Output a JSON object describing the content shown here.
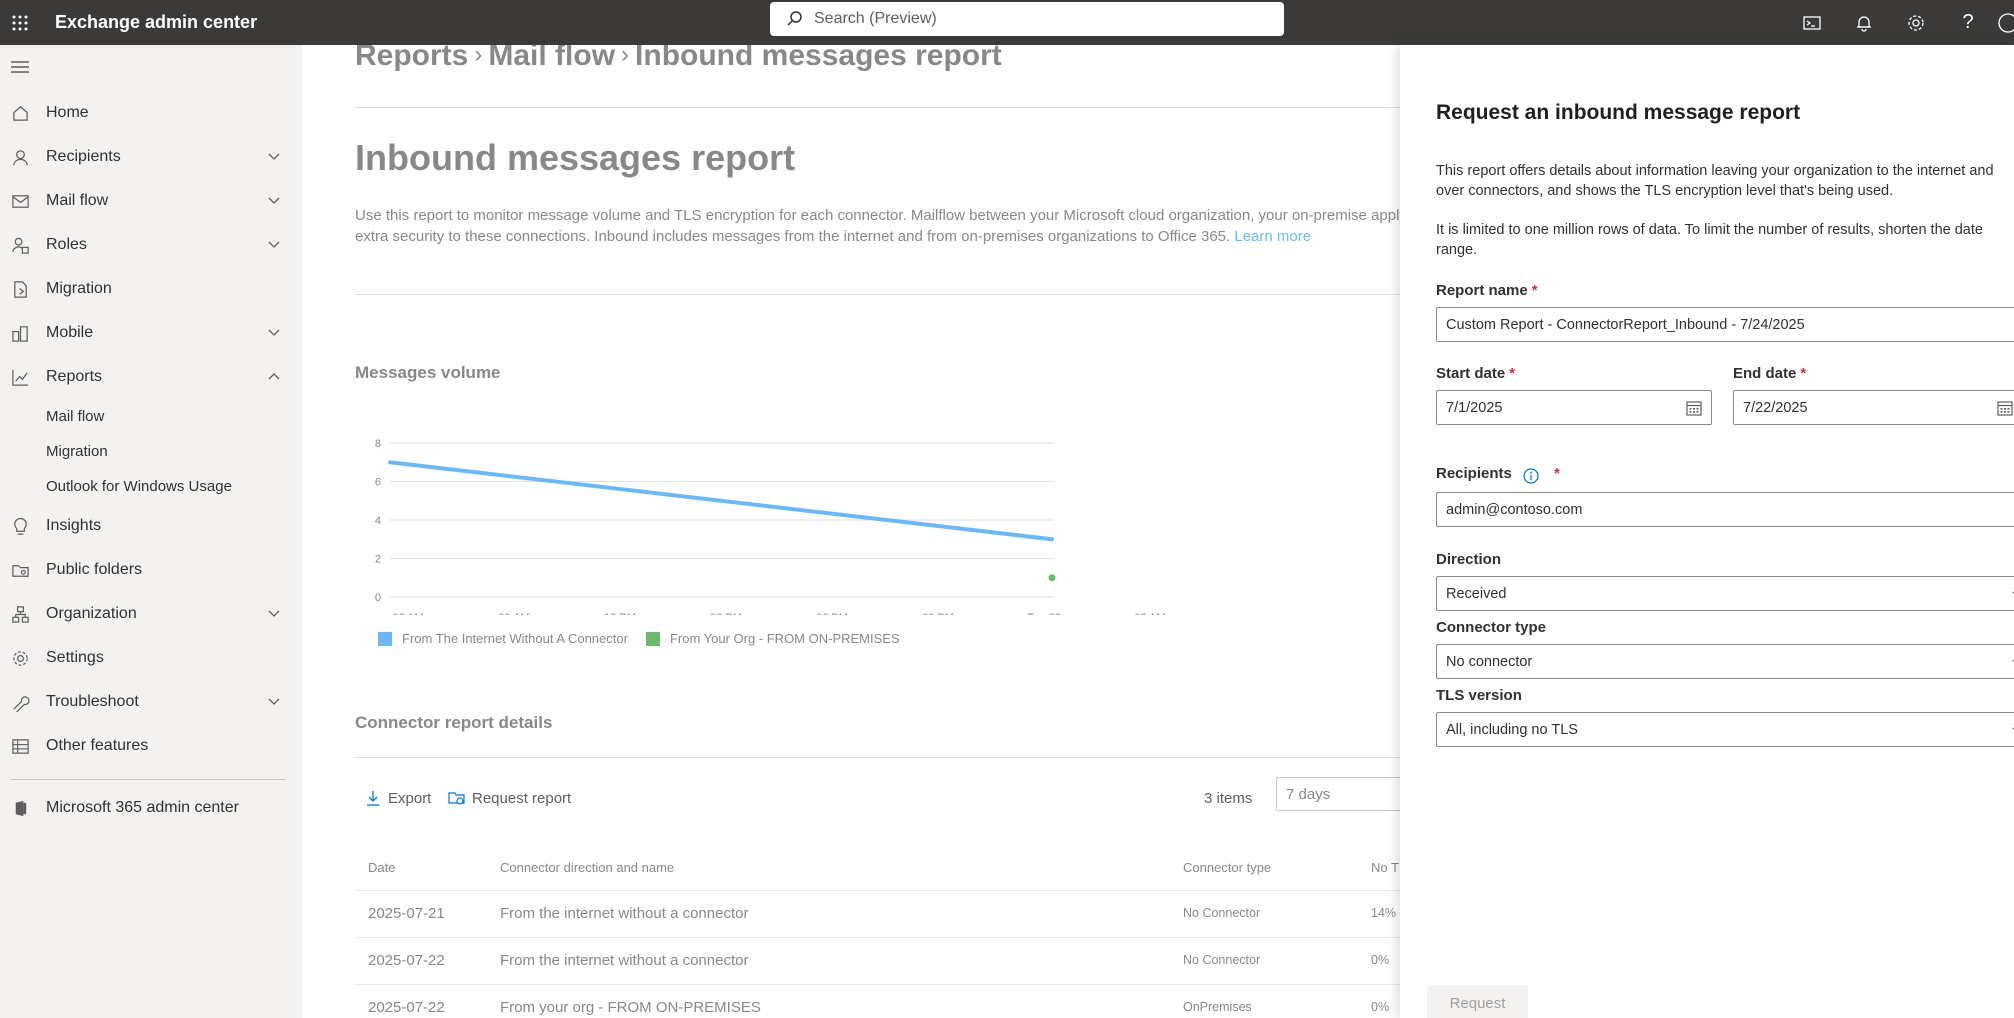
{
  "topbar": {
    "app_title": "Exchange admin center",
    "search_placeholder": "Search (Preview)",
    "icons": [
      "waffle-icon",
      "cloud-shell-icon",
      "bell-icon",
      "gear-icon",
      "help-icon"
    ]
  },
  "sidebar": {
    "items": [
      {
        "label": "Home",
        "icon": "home-icon"
      },
      {
        "label": "Recipients",
        "icon": "person-icon"
      },
      {
        "label": "Mail flow",
        "icon": "mail-icon"
      },
      {
        "label": "Roles",
        "icon": "roles-icon"
      },
      {
        "label": "Migration",
        "icon": "migration-icon"
      },
      {
        "label": "Mobile",
        "icon": "mobile-icon"
      },
      {
        "label": "Reports",
        "icon": "chart-icon"
      },
      {
        "label": "Insights",
        "icon": "lightbulb-icon"
      },
      {
        "label": "Public folders",
        "icon": "folder-icon"
      },
      {
        "label": "Organization",
        "icon": "org-icon"
      },
      {
        "label": "Settings",
        "icon": "gear-icon"
      },
      {
        "label": "Troubleshoot",
        "icon": "wrench-icon"
      },
      {
        "label": "Other features",
        "icon": "grid-icon"
      },
      {
        "label": "Microsoft 365 admin center",
        "icon": "office-icon"
      }
    ],
    "report_subitems": [
      "Mail flow",
      "Migration",
      "Outlook for Windows Usage"
    ]
  },
  "main": {
    "breadcrumb": [
      "Reports",
      "Mail flow",
      "Inbound messages report"
    ],
    "title": "Inbound messages report",
    "description": "Use this report to monitor message volume and TLS encryption for each connector. Mailflow between your Microsoft cloud organization, your on-premise apply extra security to these connections. Inbound includes messages from the internet and from on-premises organizations to Office 365.",
    "learn_more": "Learn more",
    "volume_title": "Messages volume",
    "details_title": "Connector report details",
    "export_label": "Export",
    "request_label": "Request report",
    "items_count": "3 items",
    "period_value": "7 days",
    "table": {
      "headers": [
        "Date",
        "Connector direction and name",
        "Connector type",
        "No T"
      ],
      "rows": [
        [
          "2025-07-21",
          "From the internet without a connector",
          "No Connector",
          "14%"
        ],
        [
          "2025-07-22",
          "From the internet without a connector",
          "No Connector",
          "0%"
        ],
        [
          "2025-07-22",
          "From your org - FROM ON-PREMISES",
          "OnPremises",
          "0%"
        ]
      ]
    }
  },
  "chart_data": {
    "type": "line",
    "x_ticks": [
      "06 AM",
      "09 AM",
      "12 PM",
      "03 PM",
      "06 PM",
      "09 PM",
      "Tue 22",
      "03 AM"
    ],
    "y_ticks": [
      0,
      2,
      4,
      6,
      8
    ],
    "ylim": [
      0,
      8
    ],
    "grid": true,
    "legend_position": "bottom-left",
    "series": [
      {
        "name": "From The Internet Without A Connector",
        "color": "#6cb8f6",
        "values": [
          7.0,
          3.0
        ]
      },
      {
        "name": "From Your Org - FROM ON-PREMISES",
        "color": "#6fb86f",
        "values": [
          1.0
        ]
      }
    ]
  },
  "panel": {
    "title": "Request an inbound message report",
    "text1": "This report offers details about information leaving your organization to the internet and over connectors, and shows the TLS encryption level that's being used.",
    "text2": "It is limited to one million rows of data. To limit the number of results, shorten the date range.",
    "report_name_label": "Report name",
    "report_name_value": "Custom Report - ConnectorReport_Inbound - 7/24/2025",
    "start_date_label": "Start date",
    "start_date_value": "7/1/2025",
    "end_date_label": "End date",
    "end_date_value": "7/22/2025",
    "recipients_label": "Recipients",
    "recipients_value": "admin@contoso.com",
    "direction_label": "Direction",
    "direction_value": "Received",
    "connector_type_label": "Connector type",
    "connector_type_value": "No connector",
    "tls_label": "TLS version",
    "tls_value": "All, including no TLS",
    "required_mark": "*",
    "submit_label": "Request"
  }
}
